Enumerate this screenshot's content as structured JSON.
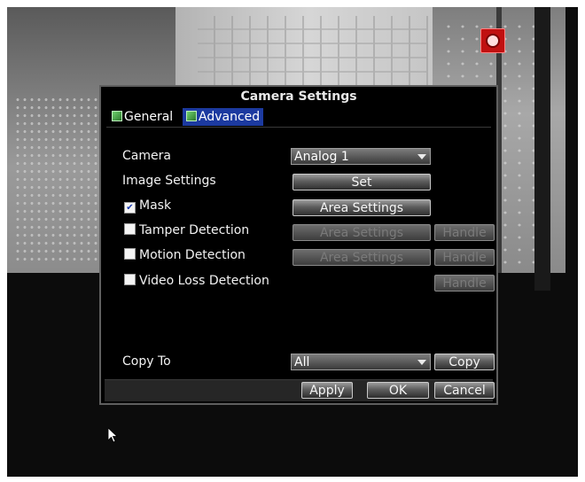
{
  "dialog": {
    "title": "Camera Settings",
    "tabs": [
      {
        "label": "General",
        "active": false
      },
      {
        "label": "Advanced",
        "active": true
      }
    ]
  },
  "form": {
    "camera_label": "Camera",
    "camera_value": "Analog 1",
    "image_settings_label": "Image Settings",
    "set_button": "Set",
    "mask": {
      "label": "Mask",
      "checked": true,
      "checkmark": "✔",
      "button": "Area Settings"
    },
    "tamper": {
      "label": "Tamper Detection",
      "checked": false,
      "area_button": "Area Settings",
      "handle_button": "Handle"
    },
    "motion": {
      "label": "Motion Detection",
      "checked": false,
      "area_button": "Area Settings",
      "handle_button": "Handle"
    },
    "video_loss": {
      "label": "Video Loss Detection",
      "checked": false,
      "handle_button": "Handle"
    },
    "copy_to_label": "Copy To",
    "copy_to_value": "All",
    "copy_button": "Copy"
  },
  "footer": {
    "apply_button": "Apply",
    "ok_button": "OK",
    "cancel_button": "Cancel"
  },
  "colors": {
    "active_tab": "#1c3aa0",
    "record_indicator": "#c01010"
  },
  "icons": [
    "record-indicator-icon",
    "tab-icon",
    "dropdown-arrow-icon",
    "mouse-cursor-icon"
  ]
}
